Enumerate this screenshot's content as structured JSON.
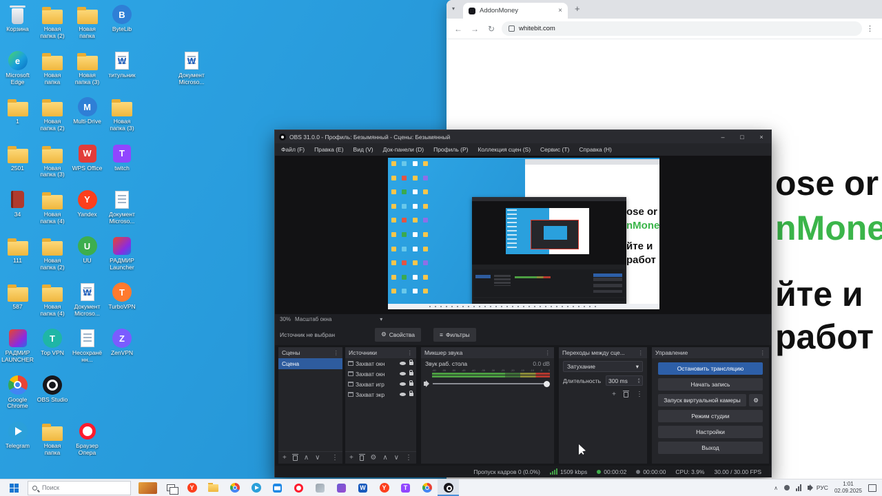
{
  "icons": {
    "plus": "+",
    "kebab": "⋮",
    "caret_down": "▾",
    "up": "∧",
    "down": "∨",
    "gear": "⚙",
    "close": "×",
    "maximize": "□",
    "minimize": "–",
    "back": "←",
    "forward": "→",
    "refresh": "↻",
    "new_tab": "+",
    "tab_caret": "▾",
    "tray_caret": "∧",
    "filter": "≡"
  },
  "colors": {
    "accent_blue": "#2d5fa8",
    "selection_blue": "#2e5c9e",
    "brand_green": "#3bb54a",
    "meter_green": "#4c9e42",
    "meter_red": "#b5382e",
    "desktop_blue": "#2aa0dd"
  },
  "desktop": {
    "icons": [
      {
        "col": 0,
        "row": 0,
        "label": "Корзина",
        "kind": "bin"
      },
      {
        "col": 1,
        "row": 0,
        "label": "Новая папка (2)",
        "kind": "folder"
      },
      {
        "col": 2,
        "row": 0,
        "label": "Новая папка",
        "kind": "folder"
      },
      {
        "col": 3,
        "row": 0,
        "label": "ByteLib",
        "kind": "app-blue"
      },
      {
        "col": 0,
        "row": 1,
        "label": "Microsoft Edge",
        "kind": "edge"
      },
      {
        "col": 1,
        "row": 1,
        "label": "Новая папка",
        "kind": "folder"
      },
      {
        "col": 2,
        "row": 1,
        "label": "Новая папка (3)",
        "kind": "folder"
      },
      {
        "col": 3,
        "row": 1,
        "label": "титульник",
        "kind": "worddoc"
      },
      {
        "col": 5,
        "row": 1,
        "label": "Документ Microso...",
        "kind": "worddoc"
      },
      {
        "col": 0,
        "row": 2,
        "label": "1",
        "kind": "folder"
      },
      {
        "col": 1,
        "row": 2,
        "label": "Новая папка (2)",
        "kind": "folder"
      },
      {
        "col": 2,
        "row": 2,
        "label": "Multi-Drive",
        "kind": "app-blue"
      },
      {
        "col": 3,
        "row": 2,
        "label": "Новая папка (3)",
        "kind": "folder"
      },
      {
        "col": 0,
        "row": 3,
        "label": "2501",
        "kind": "folder"
      },
      {
        "col": 1,
        "row": 3,
        "label": "Новая папка (3)",
        "kind": "folder"
      },
      {
        "col": 2,
        "row": 3,
        "label": "WPS Office",
        "kind": "wps"
      },
      {
        "col": 3,
        "row": 3,
        "label": "twitch",
        "kind": "twitch"
      },
      {
        "col": 0,
        "row": 4,
        "label": "34",
        "kind": "book"
      },
      {
        "col": 1,
        "row": 4,
        "label": "Новая папка (4)",
        "kind": "folder"
      },
      {
        "col": 2,
        "row": 4,
        "label": "Yandex",
        "kind": "yandex"
      },
      {
        "col": 3,
        "row": 4,
        "label": "Документ Microso...",
        "kind": "doc"
      },
      {
        "col": 0,
        "row": 5,
        "label": "111",
        "kind": "folder"
      },
      {
        "col": 1,
        "row": 5,
        "label": "Новая папка (2)",
        "kind": "folder"
      },
      {
        "col": 2,
        "row": 5,
        "label": "UU",
        "kind": "app-green"
      },
      {
        "col": 3,
        "row": 5,
        "label": "РАДМИР Launcher",
        "kind": "radmir"
      },
      {
        "col": 0,
        "row": 6,
        "label": "587",
        "kind": "folder"
      },
      {
        "col": 1,
        "row": 6,
        "label": "Новая папка (4)",
        "kind": "folder"
      },
      {
        "col": 2,
        "row": 6,
        "label": "Документ Microso...",
        "kind": "worddoc"
      },
      {
        "col": 3,
        "row": 6,
        "label": "TurboVPN",
        "kind": "app-orange"
      },
      {
        "col": 0,
        "row": 7,
        "label": "РАДМИР LAUNCHER",
        "kind": "radmir"
      },
      {
        "col": 1,
        "row": 7,
        "label": "Тор VPN",
        "kind": "app-teal"
      },
      {
        "col": 2,
        "row": 7,
        "label": "Несохранённ...",
        "kind": "doc"
      },
      {
        "col": 3,
        "row": 7,
        "label": "ZenVPN",
        "kind": "app-purple"
      },
      {
        "col": 0,
        "row": 8,
        "label": "Google Chrome",
        "kind": "chrome"
      },
      {
        "col": 1,
        "row": 8,
        "label": "OBS Studio",
        "kind": "obs"
      },
      {
        "col": 0,
        "row": 9,
        "label": "Telegram",
        "kind": "telegram"
      },
      {
        "col": 1,
        "row": 9,
        "label": "Новая папка",
        "kind": "folder"
      },
      {
        "col": 2,
        "row": 9,
        "label": "Браузер Опера",
        "kind": "opera"
      }
    ]
  },
  "browser": {
    "tab_title": "AddonMoney",
    "url": "whitebit.com",
    "content_lines": [
      {
        "text": "ose or",
        "color": "#111111"
      },
      {
        "text": "nMoney",
        "color": "#3bb54a"
      },
      {
        "text": "йте и",
        "color": "#111111"
      },
      {
        "text": "работ",
        "color": "#111111"
      }
    ]
  },
  "obs": {
    "window_title": "OBS 31.0.0 - Профиль: Безымянный - Сцены: Безымянный",
    "menu_items": [
      "Файл (F)",
      "Правка (E)",
      "Вид (V)",
      "Док-панели (D)",
      "Профиль (P)",
      "Коллекция сцен (S)",
      "Сервис (T)",
      "Справка (H)"
    ],
    "zoom_value": "30%",
    "zoom_label": "Масштаб окна",
    "no_source_label": "Источник не выбран",
    "properties_button": "Свойства",
    "filters_button": "Фильтры",
    "docks": {
      "scenes": {
        "title": "Сцены",
        "items": [
          "Сцена"
        ]
      },
      "sources": {
        "title": "Источники",
        "items": [
          "Захват окн",
          "Захват окн",
          "Захват игр",
          "Захват экр"
        ]
      },
      "mixer": {
        "title": "Микшер звука",
        "channel": "Звук раб. стола",
        "level_db": "0.0 dB",
        "scale": [
          "-60",
          "-55",
          "-50",
          "-45",
          "-40",
          "-35",
          "-30",
          "-25",
          "-20",
          "-15",
          "-10",
          "-5",
          "0"
        ]
      },
      "transitions": {
        "title": "Переходы между сце...",
        "transition": "Затухание",
        "duration_label": "Длительность",
        "duration_value": "300 ms"
      },
      "controls": {
        "title": "Управление",
        "buttons": [
          {
            "label": "Остановить трансляцию",
            "primary": true
          },
          {
            "label": "Начать запись"
          },
          {
            "label": "Запуск виртуальной камеры",
            "gear": true
          },
          {
            "label": "Режим студии"
          },
          {
            "label": "Настройки"
          },
          {
            "label": "Выход"
          }
        ]
      }
    },
    "status": {
      "dropped_frames": "Пропуск кадров 0 (0.0%)",
      "bitrate": "1509 kbps",
      "stream_time": "00:00:02",
      "record_time": "00:00:00",
      "cpu": "CPU: 3.9%",
      "fps": "30.00 / 30.00 FPS"
    }
  },
  "taskbar": {
    "search_placeholder": "Поиск",
    "apps": [
      {
        "name": "news-widget",
        "kind": "widget"
      },
      {
        "name": "task-view",
        "kind": "taskview"
      },
      {
        "name": "yandex-browser",
        "kind": "yandex"
      },
      {
        "name": "file-explorer",
        "kind": "folder"
      },
      {
        "name": "chrome",
        "kind": "chrome"
      },
      {
        "name": "telegram",
        "kind": "telegram"
      },
      {
        "name": "mail",
        "kind": "mail"
      },
      {
        "name": "opera",
        "kind": "opera"
      },
      {
        "name": "app-grey",
        "kind": "app-grey"
      },
      {
        "name": "app-violet",
        "kind": "app-violet"
      },
      {
        "name": "word",
        "kind": "word"
      },
      {
        "name": "yandex-2",
        "kind": "yandex"
      },
      {
        "name": "twitch",
        "kind": "twitch"
      },
      {
        "name": "chrome-2",
        "kind": "chrome"
      },
      {
        "name": "obs",
        "kind": "obs",
        "active": true
      }
    ],
    "tray": {
      "language": "РУС",
      "time": "1:01",
      "date": "02.09.2025"
    }
  }
}
